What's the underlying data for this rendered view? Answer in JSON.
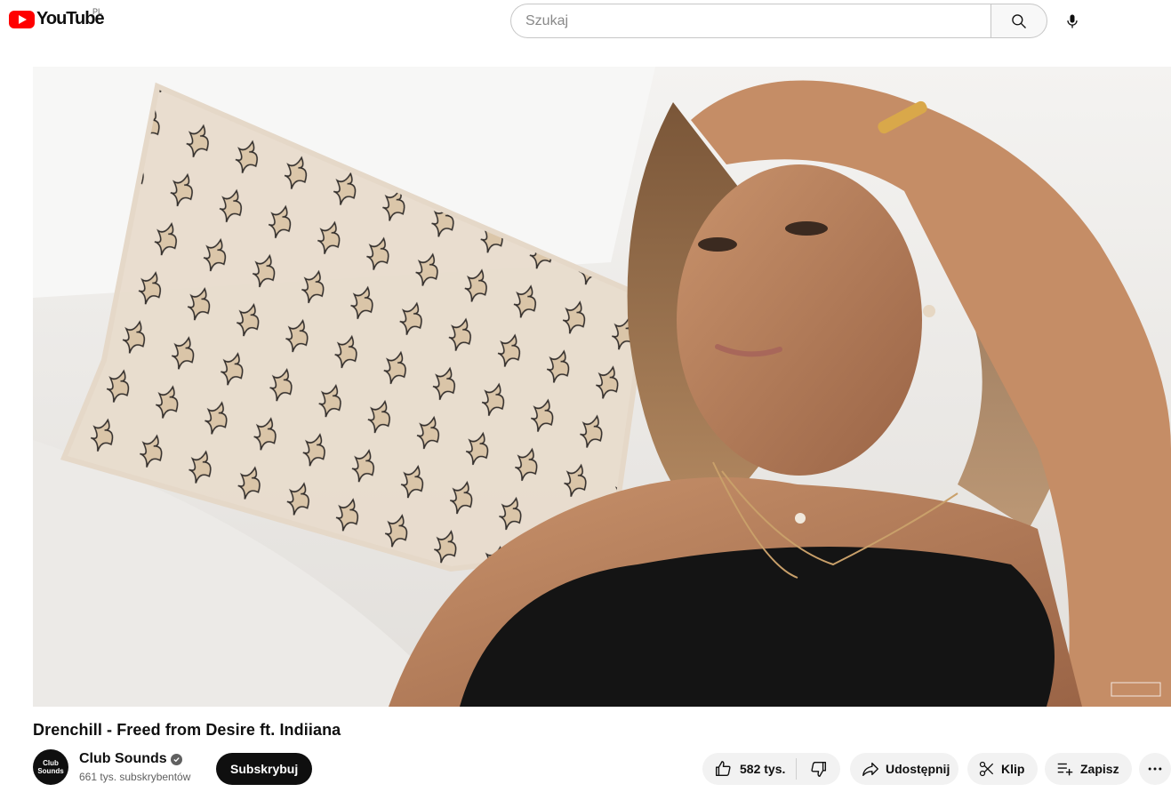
{
  "header": {
    "logo_text": "YouTube",
    "region": "PL",
    "search_placeholder": "Szukaj"
  },
  "video": {
    "title": "Drenchill - Freed from Desire ft. Indiiana"
  },
  "channel": {
    "avatar_text": "Club Sounds",
    "name": "Club Sounds",
    "subscribers": "661 tys. subskrybentów",
    "subscribe_label": "Subskrybuj"
  },
  "actions": {
    "likes": "582 tys.",
    "share_label": "Udostępnij",
    "clip_label": "Klip",
    "save_label": "Zapisz"
  },
  "icons": [
    "youtube-logo-icon",
    "search-icon",
    "mic-icon",
    "verified-icon",
    "thumbs-up-icon",
    "thumbs-down-icon",
    "share-icon",
    "scissors-icon",
    "playlist-add-icon",
    "more-icon"
  ]
}
